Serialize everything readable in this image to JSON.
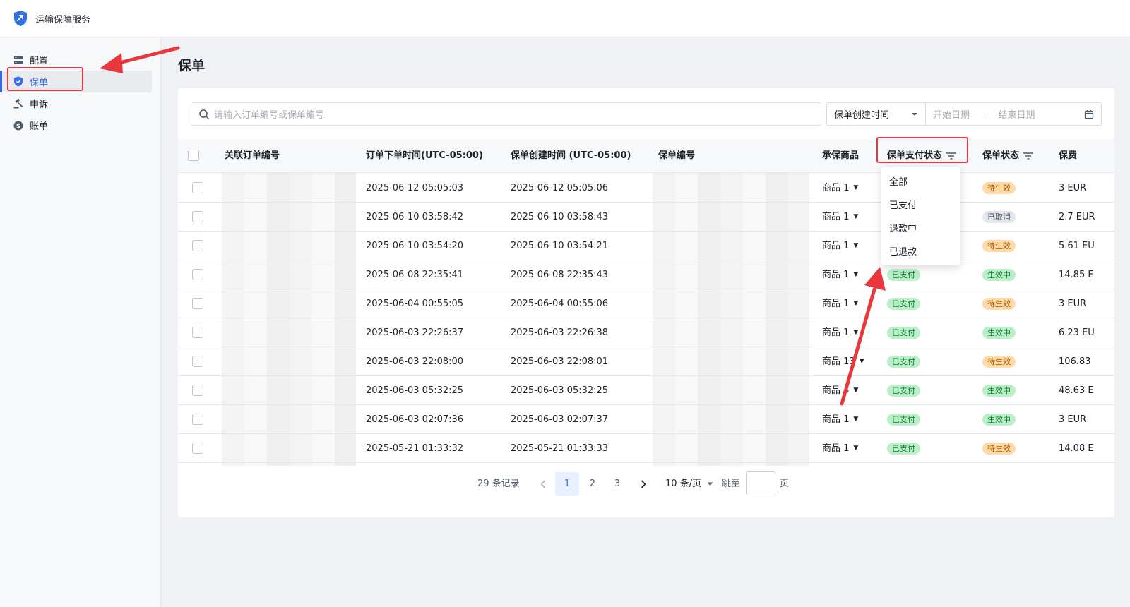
{
  "app": {
    "title": "运输保障服务"
  },
  "sidebar": {
    "items": [
      {
        "label": "配置",
        "icon": "server-icon"
      },
      {
        "label": "保单",
        "icon": "shield-icon",
        "active": true
      },
      {
        "label": "申诉",
        "icon": "gavel-icon"
      },
      {
        "label": "账单",
        "icon": "dollar-icon"
      }
    ]
  },
  "page": {
    "title": "保单"
  },
  "filters": {
    "search_placeholder": "请输入订单编号或保单编号",
    "date_type": "保单创建时间",
    "start_placeholder": "开始日期",
    "range_sep": "–",
    "end_placeholder": "结束日期"
  },
  "table": {
    "headers": {
      "order_no": "关联订单编号",
      "order_time": "订单下单时间(UTC-05:00)",
      "created": "保单创建时间 (UTC-05:00)",
      "policy_no": "保单编号",
      "product": "承保商品",
      "pay_status": "保单支付状态",
      "policy_status": "保单状态",
      "fee": "保费"
    },
    "rows": [
      {
        "order_time": "2025-06-12 05:05:03",
        "created": "2025-06-12 05:05:06",
        "product": "商品 1",
        "pay_status": "",
        "policy_status": "待生效",
        "fee": "3 EUR"
      },
      {
        "order_time": "2025-06-10 03:58:42",
        "created": "2025-06-10 03:58:43",
        "product": "商品 1",
        "pay_status": "",
        "policy_status": "已取消",
        "fee": "2.7 EUR"
      },
      {
        "order_time": "2025-06-10 03:54:20",
        "created": "2025-06-10 03:54:21",
        "product": "商品 1",
        "pay_status": "",
        "policy_status": "待生效",
        "fee": "5.61 EU"
      },
      {
        "order_time": "2025-06-08 22:35:41",
        "created": "2025-06-08 22:35:43",
        "product": "商品 1",
        "pay_status": "已支付",
        "policy_status": "生效中",
        "fee": "14.85 E"
      },
      {
        "order_time": "2025-06-04 00:55:05",
        "created": "2025-06-04 00:55:06",
        "product": "商品 1",
        "pay_status": "已支付",
        "policy_status": "待生效",
        "fee": "3 EUR"
      },
      {
        "order_time": "2025-06-03 22:26:37",
        "created": "2025-06-03 22:26:38",
        "product": "商品 1",
        "pay_status": "已支付",
        "policy_status": "生效中",
        "fee": "6.23 EU"
      },
      {
        "order_time": "2025-06-03 22:08:00",
        "created": "2025-06-03 22:08:01",
        "product": "商品 13",
        "pay_status": "已支付",
        "policy_status": "待生效",
        "fee": "106.83"
      },
      {
        "order_time": "2025-06-03 05:32:25",
        "created": "2025-06-03 05:32:25",
        "product": "商品 4",
        "pay_status": "已支付",
        "policy_status": "生效中",
        "fee": "48.63 E"
      },
      {
        "order_time": "2025-06-03 02:07:36",
        "created": "2025-06-03 02:07:37",
        "product": "商品 1",
        "pay_status": "已支付",
        "policy_status": "生效中",
        "fee": "3 EUR"
      },
      {
        "order_time": "2025-05-21 01:33:32",
        "created": "2025-05-21 01:33:33",
        "product": "商品 1",
        "pay_status": "已支付",
        "policy_status": "待生效",
        "fee": "14.08 E"
      }
    ]
  },
  "pay_filter_menu": {
    "options": [
      "全部",
      "已支付",
      "退款中",
      "已退款"
    ]
  },
  "pagination": {
    "total": "29 条记录",
    "pages": [
      "1",
      "2",
      "3"
    ],
    "current": "1",
    "page_size": "10 条/页",
    "jump_label": "跳至",
    "page_suffix": "页"
  },
  "colors": {
    "accent": "#3b6cf0",
    "annotation_red": "#e8383d",
    "tag_green_bg": "#b9f0c7",
    "tag_orange_bg": "#ffd9a8",
    "tag_gray_bg": "#e5e6eb"
  }
}
